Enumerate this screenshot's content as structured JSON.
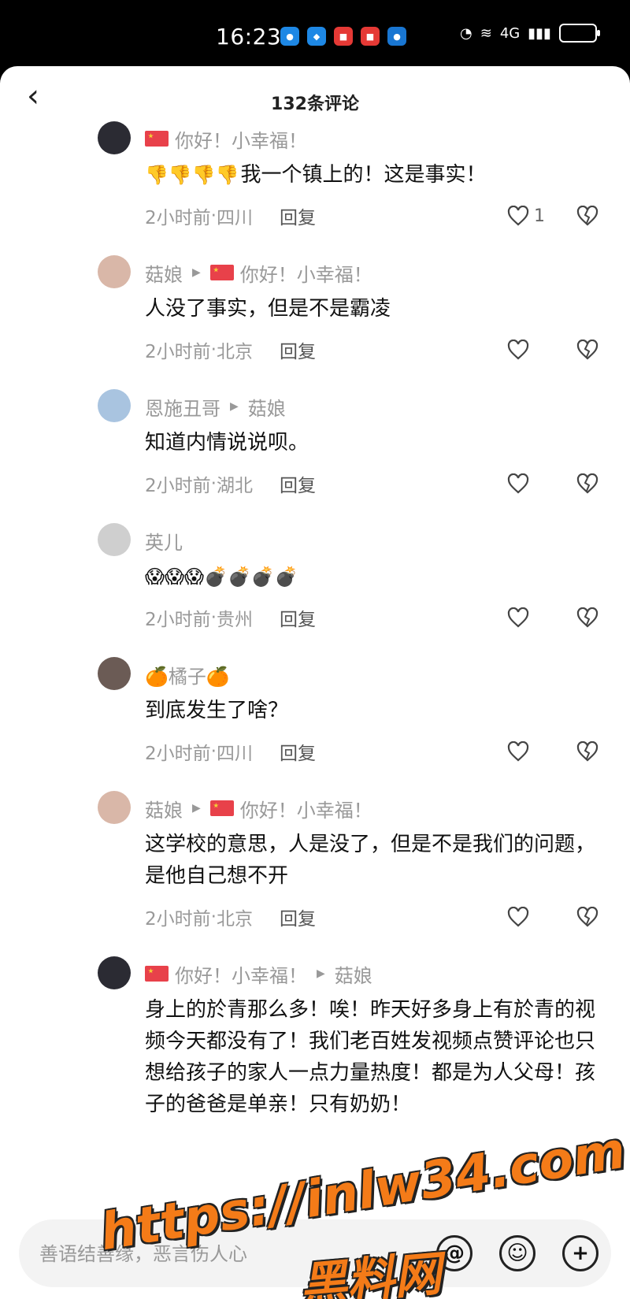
{
  "status_bar": {
    "time": "16:23",
    "network": "4G"
  },
  "header": {
    "title": "132条评论"
  },
  "comments": [
    {
      "author": "你好！小幸福！",
      "author_flag": true,
      "reply_to": "",
      "reply_to_flag": false,
      "text": "我一个镇上的！这是事实！",
      "emoji_prefix": "👎👎👎👎",
      "time": "2小时前",
      "location": "四川",
      "reply_label": "回复",
      "likes": "1"
    },
    {
      "author": "菇娘",
      "author_flag": false,
      "reply_to": "你好！小幸福！",
      "reply_to_flag": true,
      "text": "人没了事实，但是不是霸凌",
      "emoji_prefix": "",
      "time": "2小时前",
      "location": "北京",
      "reply_label": "回复",
      "likes": ""
    },
    {
      "author": "恩施丑哥",
      "author_flag": false,
      "reply_to": "菇娘",
      "reply_to_flag": false,
      "text": "知道内情说说呗。",
      "emoji_prefix": "",
      "time": "2小时前",
      "location": "湖北",
      "reply_label": "回复",
      "likes": ""
    },
    {
      "author": "英儿",
      "author_flag": false,
      "reply_to": "",
      "reply_to_flag": false,
      "text": "",
      "emoji_prefix": "😱😱😱💣💣💣💣",
      "time": "2小时前",
      "location": "贵州",
      "reply_label": "回复",
      "likes": ""
    },
    {
      "author": "🍊橘子🍊",
      "author_flag": false,
      "reply_to": "",
      "reply_to_flag": false,
      "text": "到底发生了啥？",
      "emoji_prefix": "",
      "time": "2小时前",
      "location": "四川",
      "reply_label": "回复",
      "likes": ""
    },
    {
      "author": "菇娘",
      "author_flag": false,
      "reply_to": "你好！小幸福！",
      "reply_to_flag": true,
      "text": "这学校的意思，人是没了，但是不是我们的问题，是他自己想不开",
      "emoji_prefix": "",
      "time": "2小时前",
      "location": "北京",
      "reply_label": "回复",
      "likes": ""
    },
    {
      "author": "你好！小幸福！",
      "author_flag": true,
      "reply_to": "菇娘",
      "reply_to_flag": false,
      "text": "身上的於青那么多！唉！昨天好多身上有於青的视频今天都没有了！我们老百姓发视频点赞评论也只想给孩子的家人一点力量热度！都是为人父母！孩子的爸爸是单亲！只有奶奶！",
      "emoji_prefix": "",
      "time": "",
      "location": "",
      "reply_label": "",
      "likes": ""
    }
  ],
  "input": {
    "placeholder": "善语结善缘，恶言伤人心"
  },
  "watermark": {
    "line1": "https://inlw34.com",
    "line2": "黑料网"
  },
  "colors": {
    "accent": "#f47b18",
    "background": "#ffffff",
    "muted": "#999999"
  }
}
